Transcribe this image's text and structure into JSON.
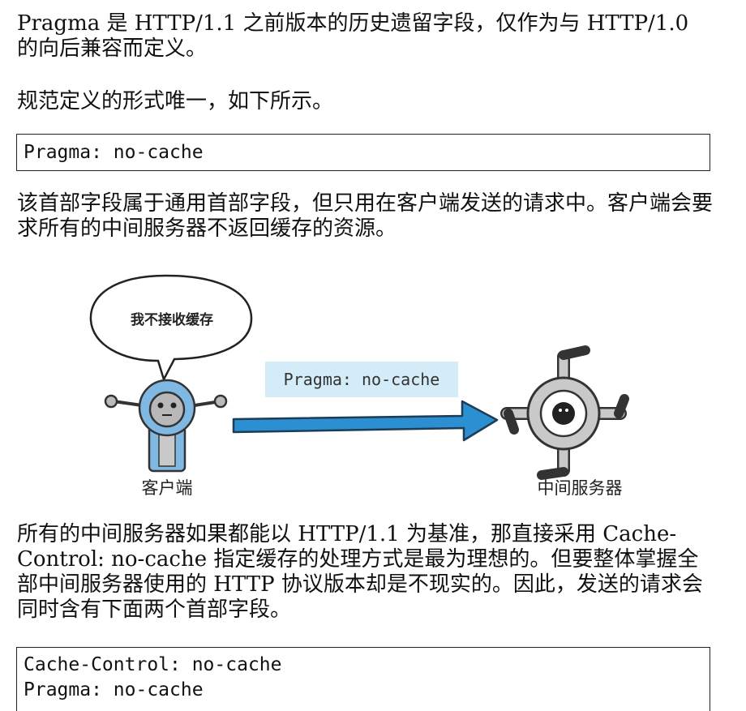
{
  "paragraphs": {
    "p1": "Pragma 是 HTTP/1.1 之前版本的历史遗留字段，仅作为与 HTTP/1.0 的向后兼容而定义。",
    "p2": "规范定义的形式唯一，如下所示。",
    "p3": "该首部字段属于通用首部字段，但只用在客户端发送的请求中。客户端会要求所有的中间服务器不返回缓存的资源。",
    "p4": "所有的中间服务器如果都能以 HTTP/1.1 为基准，那直接采用 Cache-Control: no-cache 指定缓存的处理方式是最为理想的。但要整体掌握全部中间服务器使用的 HTTP 协议版本却是不现实的。因此，发送的请求会同时含有下面两个首部字段。"
  },
  "code_blocks": {
    "first": [
      "Pragma: no-cache"
    ],
    "second": [
      "Cache-Control: no-cache",
      "Pragma: no-cache"
    ]
  },
  "illustration": {
    "speech_bubble": "我不接收缓存",
    "header_label": "Pragma: no-cache",
    "client_label": "客户端",
    "server_label": "中间服务器",
    "colors": {
      "robot_blue": "#7fb8e2",
      "arrow_blue": "#2b8fd1",
      "label_bg": "#d4ecf7",
      "server_gray": "#c9c9c9"
    }
  }
}
